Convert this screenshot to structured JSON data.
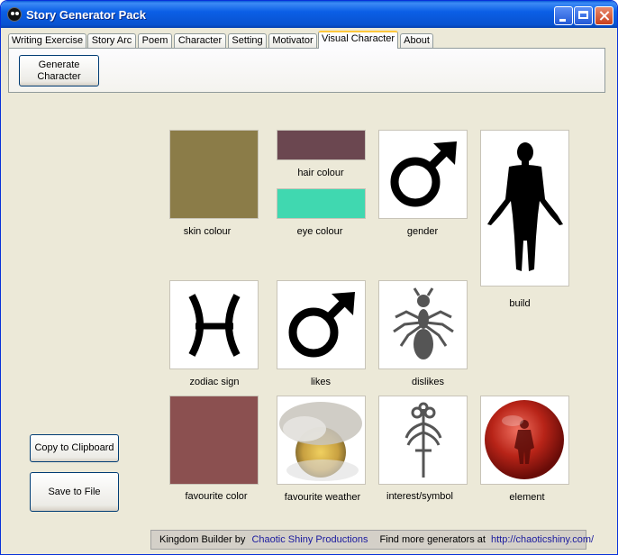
{
  "window": {
    "title": "Story Generator Pack"
  },
  "tabs": [
    {
      "label": "Writing Exercise",
      "active": false
    },
    {
      "label": "Story Arc",
      "active": false
    },
    {
      "label": "Poem",
      "active": false
    },
    {
      "label": "Character",
      "active": false
    },
    {
      "label": "Setting",
      "active": false
    },
    {
      "label": "Motivator",
      "active": false
    },
    {
      "label": "Visual Character",
      "active": true
    },
    {
      "label": "About",
      "active": false
    }
  ],
  "toolbar": {
    "generate_label": "Generate Character"
  },
  "attributes": {
    "skin_colour": {
      "label": "skin colour",
      "color": "#8b7c48"
    },
    "hair_colour": {
      "label": "hair colour",
      "color": "#6b4750"
    },
    "eye_colour": {
      "label": "eye colour",
      "color": "#40d8b0"
    },
    "gender": {
      "label": "gender",
      "icon": "male-symbol-icon"
    },
    "build": {
      "label": "build",
      "icon": "human-silhouette-icon"
    },
    "zodiac_sign": {
      "label": "zodiac sign",
      "icon": "pisces-symbol-icon"
    },
    "likes": {
      "label": "likes",
      "icon": "male-symbol-icon"
    },
    "dislikes": {
      "label": "dislikes",
      "icon": "ant-icon"
    },
    "favourite_color": {
      "label": "favourite color",
      "color": "#8b5050"
    },
    "favourite_weather": {
      "label": "favourite weather",
      "icon": "cloudy-sun-icon"
    },
    "interest_symbol": {
      "label": "interest/symbol",
      "icon": "wheat-staff-icon"
    },
    "element": {
      "label": "element",
      "icon": "fire-element-icon"
    }
  },
  "actions": {
    "copy_label": "Copy to Clipboard",
    "save_label": "Save to File"
  },
  "footer": {
    "prefix": "Kingdom Builder by",
    "company": "Chaotic Shiny Productions",
    "more_text": "Find more generators at",
    "url": "http://chaoticshiny.com/"
  }
}
